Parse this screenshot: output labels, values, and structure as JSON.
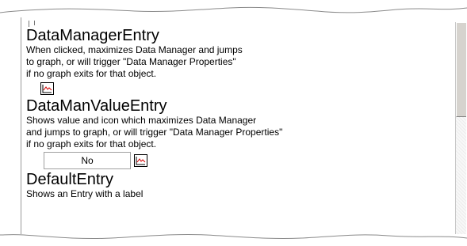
{
  "entries": [
    {
      "title": "DataManagerEntry",
      "lines": [
        "When clicked, maximizes Data Manager and jumps",
        "to graph, or will trigger \"Data Manager Properties\"",
        "if no graph exits for that object."
      ]
    },
    {
      "title": "DataManValueEntry",
      "lines": [
        "Shows value and icon which maximizes Data Manager",
        "and jumps to graph, or will trigger \"Data Manager Properties\"",
        "if no graph exits for that object."
      ],
      "value": "No"
    },
    {
      "title": "DefaultEntry",
      "lines": [
        "Shows an Entry with a label"
      ]
    }
  ],
  "icons": {
    "chart": "line-chart-icon"
  },
  "colors": {
    "chart_line": "#d40000"
  }
}
